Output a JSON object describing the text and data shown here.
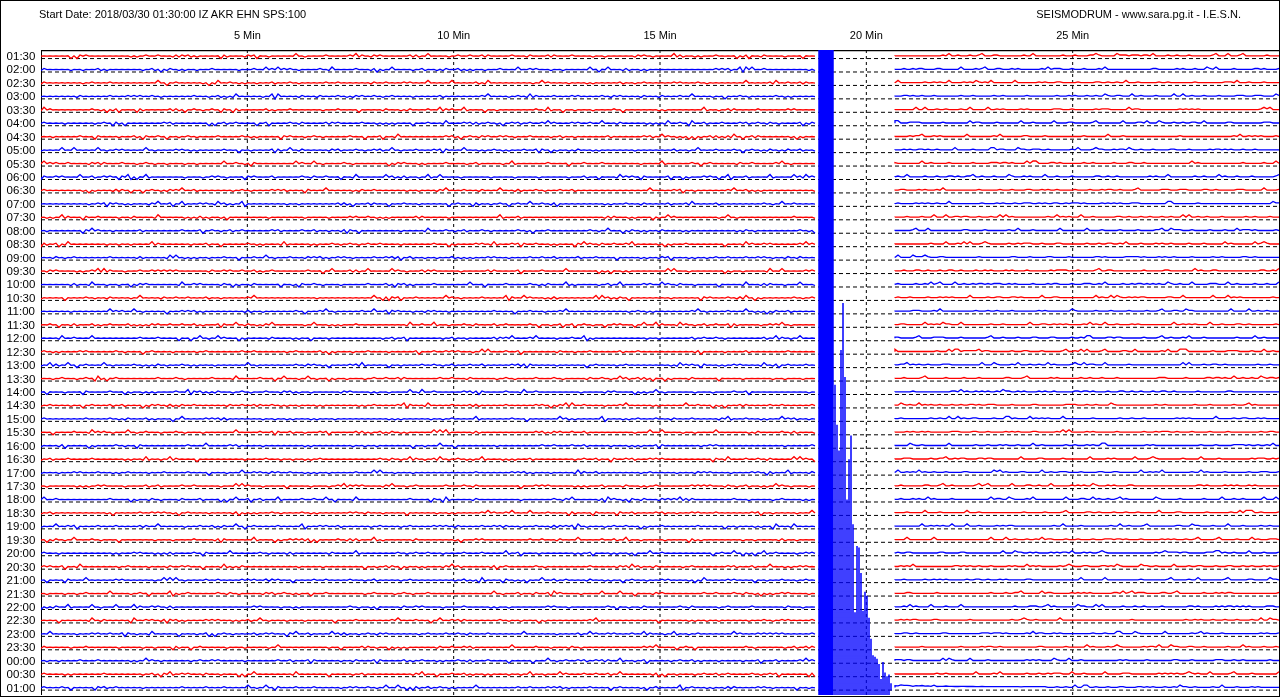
{
  "header": {
    "title": "Start Date: 2018/03/30 01:30:00 IZ AKR EHN SPS:100",
    "credit": "SEISMODRUM - www.sara.pg.it - I.E.S.N."
  },
  "minute_labels": [
    "5 Min",
    "10 Min",
    "15 Min",
    "20 Min",
    "25 Min"
  ],
  "rows": [
    {
      "time": "01:30",
      "color": "#ff0000"
    },
    {
      "time": "02:00",
      "color": "#0000ff"
    },
    {
      "time": "02:30",
      "color": "#ff0000"
    },
    {
      "time": "03:00",
      "color": "#0000ff"
    },
    {
      "time": "03:30",
      "color": "#ff0000"
    },
    {
      "time": "04:00",
      "color": "#0000ff"
    },
    {
      "time": "04:30",
      "color": "#ff0000"
    },
    {
      "time": "05:00",
      "color": "#0000ff"
    },
    {
      "time": "05:30",
      "color": "#ff0000"
    },
    {
      "time": "06:00",
      "color": "#0000ff"
    },
    {
      "time": "06:30",
      "color": "#ff0000"
    },
    {
      "time": "07:00",
      "color": "#0000ff"
    },
    {
      "time": "07:30",
      "color": "#ff0000"
    },
    {
      "time": "08:00",
      "color": "#0000ff"
    },
    {
      "time": "08:30",
      "color": "#ff0000"
    },
    {
      "time": "09:00",
      "color": "#0000ff"
    },
    {
      "time": "09:30",
      "color": "#ff0000"
    },
    {
      "time": "10:00",
      "color": "#0000ff"
    },
    {
      "time": "10:30",
      "color": "#ff0000"
    },
    {
      "time": "11:00",
      "color": "#0000ff"
    },
    {
      "time": "11:30",
      "color": "#ff0000"
    },
    {
      "time": "12:00",
      "color": "#0000ff"
    },
    {
      "time": "12:30",
      "color": "#ff0000"
    },
    {
      "time": "13:00",
      "color": "#0000ff"
    },
    {
      "time": "13:30",
      "color": "#ff0000"
    },
    {
      "time": "14:00",
      "color": "#0000ff"
    },
    {
      "time": "14:30",
      "color": "#ff0000"
    },
    {
      "time": "15:00",
      "color": "#0000ff"
    },
    {
      "time": "15:30",
      "color": "#ff0000"
    },
    {
      "time": "16:00",
      "color": "#0000ff"
    },
    {
      "time": "16:30",
      "color": "#ff0000"
    },
    {
      "time": "17:00",
      "color": "#0000ff"
    },
    {
      "time": "17:30",
      "color": "#ff0000"
    },
    {
      "time": "18:00",
      "color": "#0000ff"
    },
    {
      "time": "18:30",
      "color": "#ff0000"
    },
    {
      "time": "19:00",
      "color": "#0000ff"
    },
    {
      "time": "19:30",
      "color": "#ff0000"
    },
    {
      "time": "20:00",
      "color": "#0000ff"
    },
    {
      "time": "20:30",
      "color": "#ff0000"
    },
    {
      "time": "21:00",
      "color": "#0000ff"
    },
    {
      "time": "21:30",
      "color": "#ff0000"
    },
    {
      "time": "22:00",
      "color": "#0000ff"
    },
    {
      "time": "22:30",
      "color": "#ff0000"
    },
    {
      "time": "23:00",
      "color": "#0000ff"
    },
    {
      "time": "23:30",
      "color": "#ff0000"
    },
    {
      "time": "00:00",
      "color": "#0000ff"
    },
    {
      "time": "00:30",
      "color": "#ff0000"
    },
    {
      "time": "01:00",
      "color": "#0000ff"
    }
  ]
}
